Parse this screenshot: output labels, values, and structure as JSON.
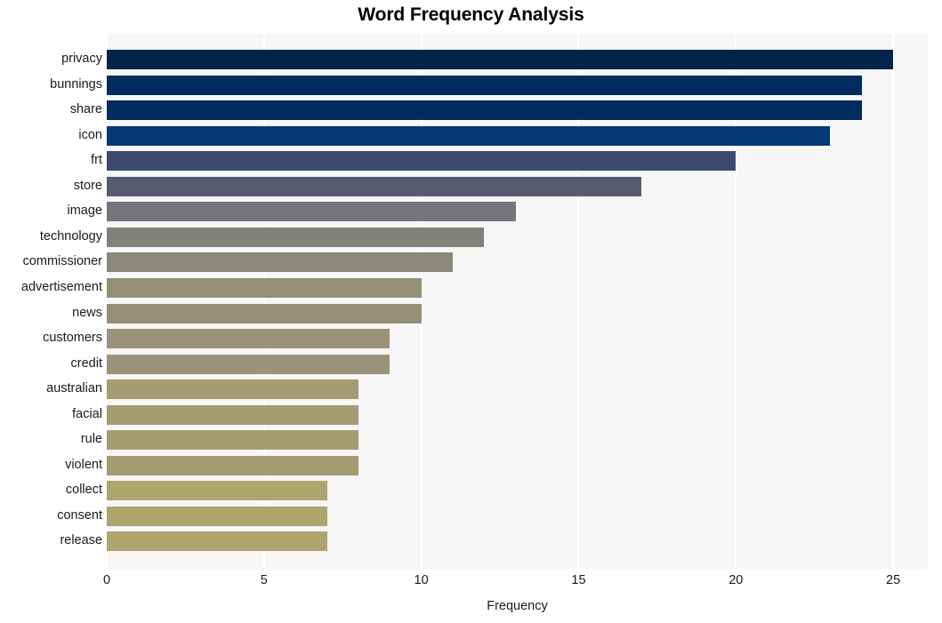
{
  "chart_data": {
    "type": "bar",
    "orientation": "horizontal",
    "title": "Word Frequency Analysis",
    "xlabel": "Frequency",
    "ylabel": "",
    "xlim": [
      0,
      26.1
    ],
    "xticks": [
      0,
      5,
      10,
      15,
      20,
      25
    ],
    "xtick_labels": [
      "0",
      "5",
      "10",
      "15",
      "20",
      "25"
    ],
    "grid": true,
    "grid_axis": "x",
    "legend": false,
    "categories": [
      "privacy",
      "bunnings",
      "share",
      "icon",
      "frt",
      "store",
      "image",
      "technology",
      "commissioner",
      "advertisement",
      "news",
      "customers",
      "credit",
      "australian",
      "facial",
      "rule",
      "violent",
      "collect",
      "consent",
      "release"
    ],
    "values": [
      25,
      24,
      24,
      23,
      20,
      17,
      13,
      12,
      11,
      10,
      10,
      9,
      9,
      8,
      8,
      8,
      8,
      7,
      7,
      7
    ],
    "bar_colors": [
      "#04254b",
      "#032b5d",
      "#032b5d",
      "#043a77",
      "#3c4a70",
      "#565b72",
      "#75757a",
      "#82807a",
      "#8b8877",
      "#958f77",
      "#958f77",
      "#9a9379",
      "#9a9379",
      "#a69c72",
      "#a69c72",
      "#a69c72",
      "#a69c72",
      "#ada46e",
      "#ada46e",
      "#ada46e"
    ]
  },
  "style": {
    "plot_background": "#f6f6f6",
    "grid_color": "#ffffff",
    "page_background": "#ffffff",
    "text_color": "#1a1a1a"
  }
}
